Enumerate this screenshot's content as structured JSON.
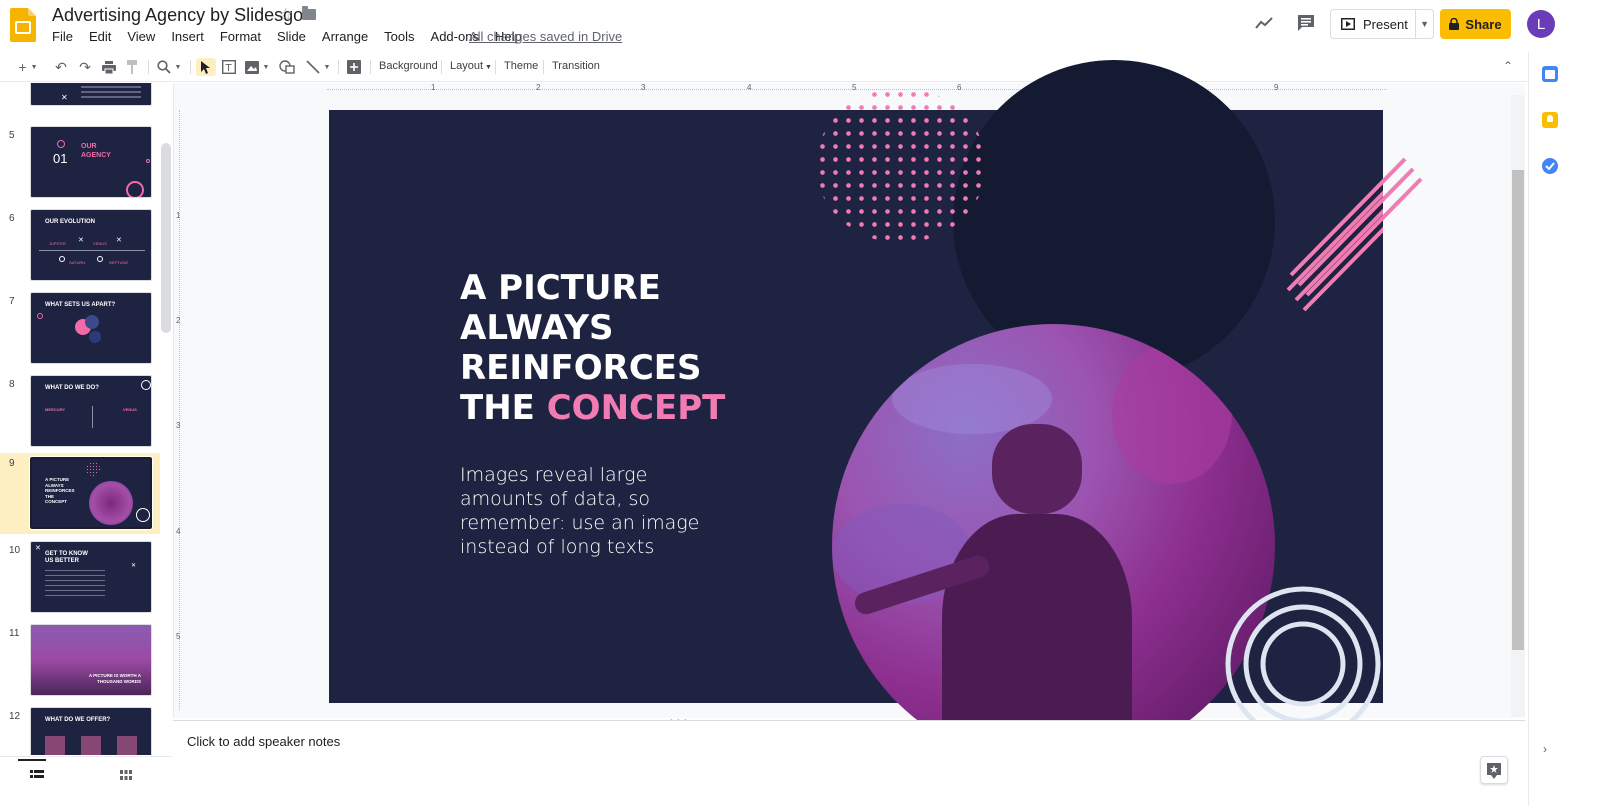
{
  "app": {
    "doc_title": "Advertising Agency by Slidesgo",
    "saved_status": "All changes saved in Drive",
    "present_label": "Present",
    "share_label": "Share",
    "avatar_initial": "L"
  },
  "menu": [
    "File",
    "Edit",
    "View",
    "Insert",
    "Format",
    "Slide",
    "Arrange",
    "Tools",
    "Add-ons",
    "Help"
  ],
  "toolbar": {
    "background_label": "Background",
    "layout_label": "Layout",
    "theme_label": "Theme",
    "transition_label": "Transition"
  },
  "ruler": {
    "top_ticks": [
      "1",
      "2",
      "3",
      "4",
      "5",
      "6",
      "7",
      "8",
      "9"
    ],
    "left_ticks": [
      "1",
      "2",
      "3",
      "4",
      "5"
    ]
  },
  "filmstrip": {
    "slides": [
      {
        "num": "5",
        "title": "OUR AGENCY",
        "number_text": "01"
      },
      {
        "num": "6",
        "title": "OUR EVOLUTION",
        "labels": [
          "JUPITER",
          "VENUS",
          "SATURN",
          "NEPTUNE"
        ]
      },
      {
        "num": "7",
        "title": "WHAT SETS US APART?"
      },
      {
        "num": "8",
        "title": "WHAT DO WE DO?",
        "labels": [
          "MERCURY",
          "VENUS"
        ]
      },
      {
        "num": "9",
        "title": "A PICTURE ALWAYS REINFORCES THE CONCEPT",
        "selected": true
      },
      {
        "num": "10",
        "title": "GET TO KNOW US BETTER"
      },
      {
        "num": "11",
        "title": "A PICTURE IS WORTH A THOUSAND WORDS"
      },
      {
        "num": "12",
        "title": "WHAT DO WE OFFER?"
      }
    ]
  },
  "slide": {
    "headline_lines": [
      "A PICTURE",
      "ALWAYS",
      "REINFORCES"
    ],
    "headline_last_prefix": "THE ",
    "headline_highlight": "CONCEPT",
    "body": "Images reveal large amounts of data, so remember: use an image instead of long texts"
  },
  "notes": {
    "placeholder": "Click to add speaker notes"
  },
  "colors": {
    "slide_bg": "#1e2341",
    "accent_pink": "#f07cb3",
    "share_yellow": "#fbbc04",
    "avatar_purple": "#6a3cba"
  }
}
